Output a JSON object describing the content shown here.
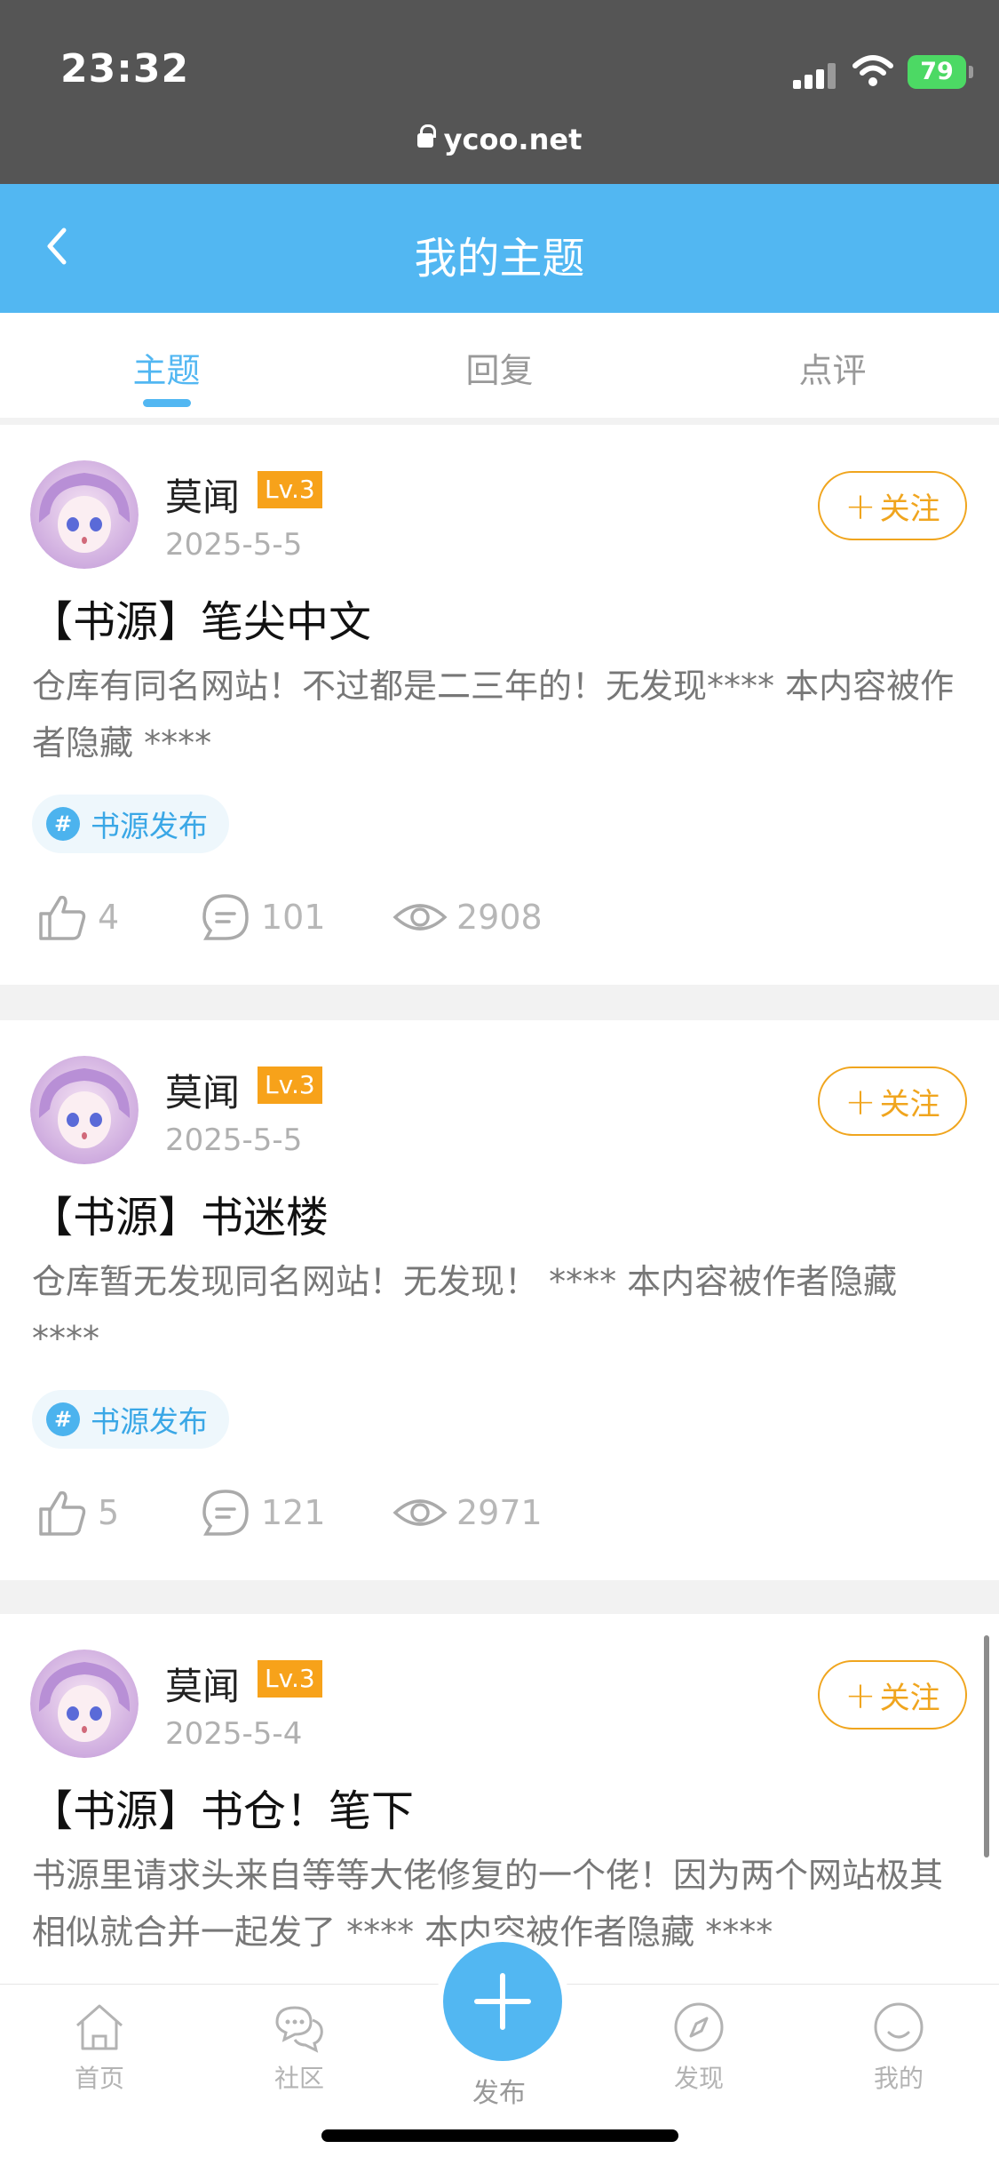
{
  "status_bar": {
    "time": "23:32",
    "url": "ycoo.net",
    "battery": "79"
  },
  "nav": {
    "title": "我的主题",
    "back_icon": "chevron-left-icon"
  },
  "tabs": [
    {
      "label": "主题",
      "active": true
    },
    {
      "label": "回复",
      "active": false
    },
    {
      "label": "点评",
      "active": false
    }
  ],
  "posts": [
    {
      "author": "莫闻",
      "level": "Lv.3",
      "date": "2025-5-5",
      "follow_label": "关注",
      "title": "【书源】笔尖中文",
      "excerpt": "仓库有同名网站！不过都是二三年的！无发现**** 本内容被作者隐藏 ****",
      "tag": "书源发布",
      "likes": "4",
      "comments": "101",
      "views": "2908"
    },
    {
      "author": "莫闻",
      "level": "Lv.3",
      "date": "2025-5-5",
      "follow_label": "关注",
      "title": "【书源】书迷楼",
      "excerpt": "仓库暂无发现同名网站！无发现！ **** 本内容被作者隐藏 ****",
      "tag": "书源发布",
      "likes": "5",
      "comments": "121",
      "views": "2971"
    },
    {
      "author": "莫闻",
      "level": "Lv.3",
      "date": "2025-5-4",
      "follow_label": "关注",
      "title": "【书源】书仓！笔下",
      "excerpt": "书源里请求头来自等等大佬修复的一个佬！因为两个网站极其相似就合并一起发了 **** 本内容被作者隐藏 ****"
    }
  ],
  "tabbar": {
    "items": [
      {
        "label": "首页",
        "icon": "home-icon"
      },
      {
        "label": "社区",
        "icon": "chat-bubbles-icon"
      },
      {
        "label": "发布",
        "icon": "plus-icon"
      },
      {
        "label": "发现",
        "icon": "compass-icon"
      },
      {
        "label": "我的",
        "icon": "smiley-icon"
      }
    ]
  },
  "colors": {
    "accent": "#52b7f2",
    "level_badge": "#f7a21a",
    "follow": "#f0a51e",
    "status_bar": "#555555"
  }
}
